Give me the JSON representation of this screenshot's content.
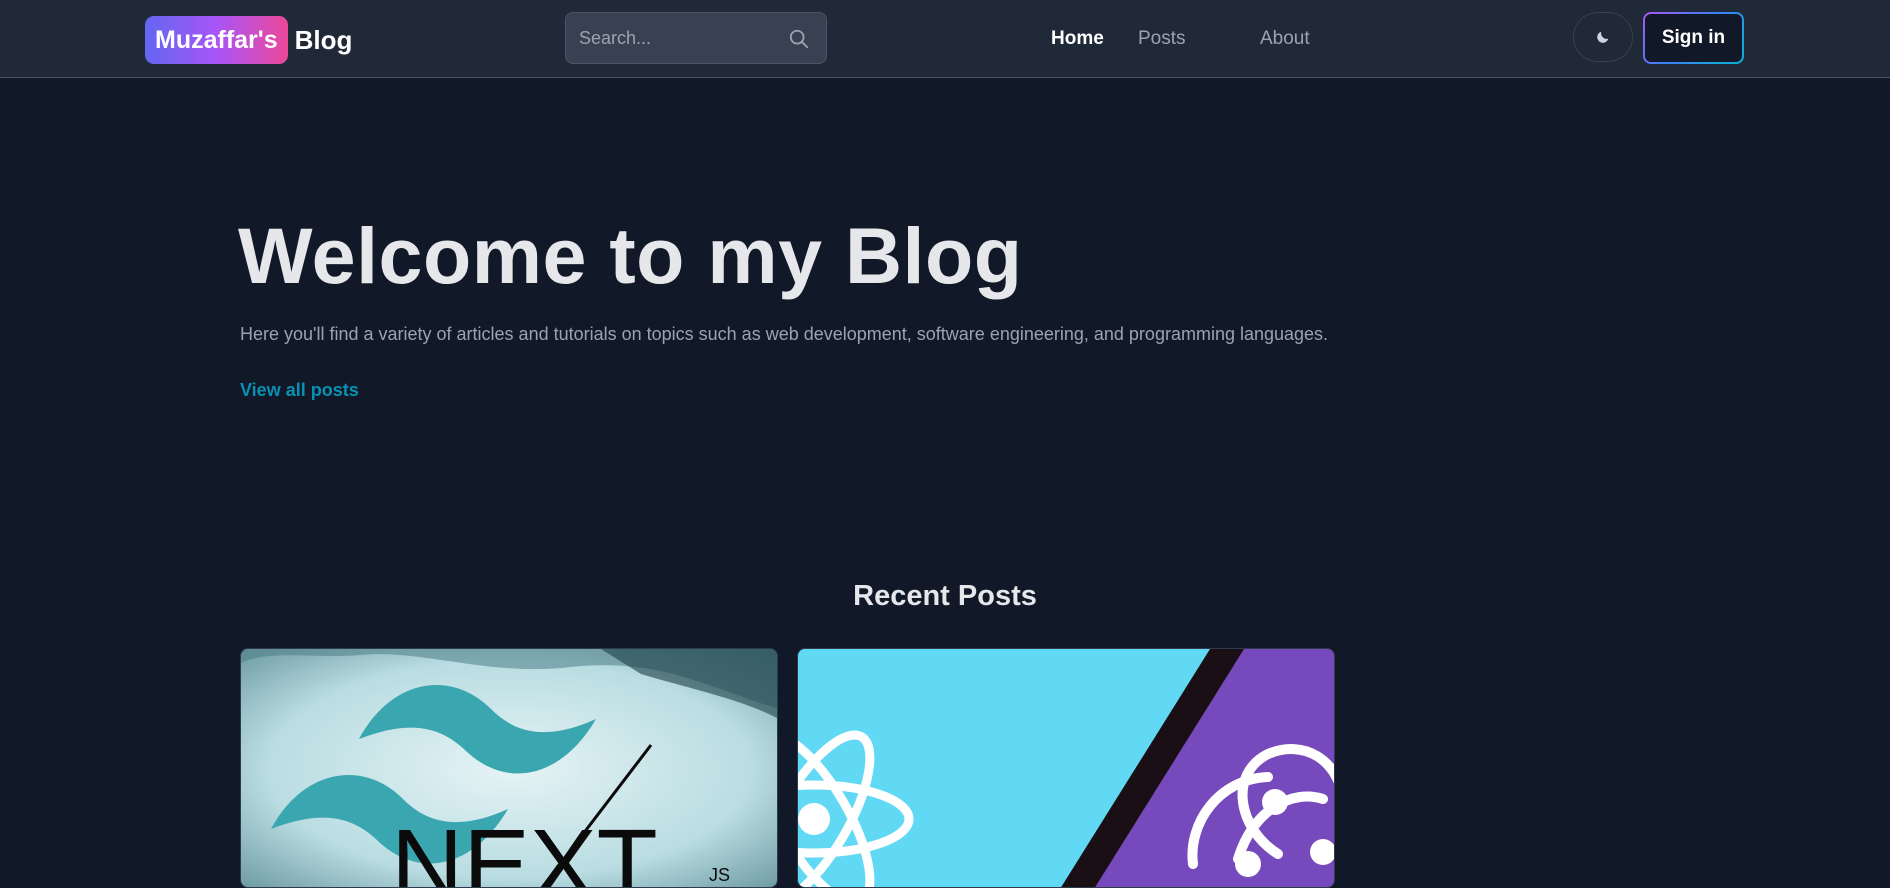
{
  "header": {
    "logo_badge": "Muzaffar's",
    "logo_text": "Blog",
    "search": {
      "placeholder": "Search..."
    },
    "nav": [
      {
        "label": "Home",
        "active": true
      },
      {
        "label": "Posts",
        "active": false
      },
      {
        "label": "About",
        "active": false
      }
    ],
    "theme_toggle_icon": "moon-icon",
    "signin_label": "Sign in"
  },
  "hero": {
    "title": "Welcome to my Blog",
    "subtitle": "Here you'll find a variety of articles and tutorials on topics such as web development, software engineering, and programming languages.",
    "link_label": "View all posts"
  },
  "recent": {
    "title": "Recent Posts",
    "posts": [
      {
        "image": "tailwind-nextjs-cover",
        "image_text": "NEXT",
        "image_subtext": "JS"
      },
      {
        "image": "react-redux-cover"
      }
    ]
  },
  "colors": {
    "page_bg": "#111827",
    "nav_bg": "#1f2937",
    "accent_link": "#0891b2",
    "logo_gradient": [
      "#6366f1",
      "#a855f7",
      "#ec4899"
    ]
  }
}
